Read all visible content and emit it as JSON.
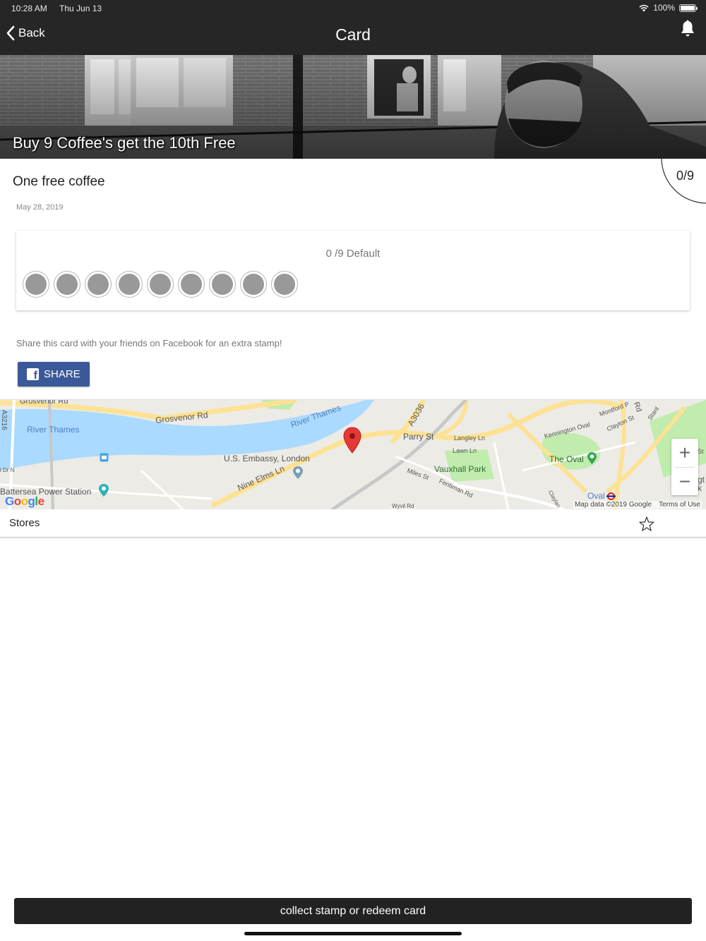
{
  "status_bar": {
    "time": "10:28 AM",
    "date": "Thu Jun 13",
    "battery": "100%"
  },
  "nav": {
    "back_label": "Back",
    "title": "Card",
    "icons": [
      "chevron-left-icon",
      "bell-icon"
    ]
  },
  "hero": {
    "title": "Buy 9 Coffee's get the 10th Free"
  },
  "card": {
    "name": "One free coffee",
    "date": "May 28, 2019",
    "progress": "0/9",
    "progress_fraction": 0
  },
  "stamps": {
    "label": "0 /9 Default",
    "total": 9,
    "collected": 0,
    "empty_color": "#999999"
  },
  "share": {
    "text": "Share this card with your friends on Facebook for an extra stamp!",
    "button_label": "SHARE",
    "button_color": "#3b5998"
  },
  "map": {
    "labels": {
      "grosvenor_rd_top": "Grosvenor Rd",
      "a3216": "A3216",
      "river_thames_left": "River Thames",
      "grosvenor_rd": "Grosvenor Rd",
      "river_thames_right": "River Thames",
      "a3036": "A3036",
      "parry_st": "Parry St",
      "langley_ln": "Langley Ln",
      "lawn_ln": "Lawn Ln",
      "kennington_oval": "Kennington Oval",
      "montford": "Montford P",
      "clayton_st": "Clayton St",
      "rd_vertical": "Rd",
      "us_embassy": "U.S. Embassy, London",
      "vauxhall_park": "Vauxhall Park",
      "the_oval": "The Oval",
      "nine_elms_ln": "Nine Elms Ln",
      "miles_st": "Miles St",
      "fentiman_rd": "Fentiman Rd",
      "battersea": "Battersea Power Station",
      "oval": "Oval",
      "wyvil_rd": "Wyvil Rd",
      "claylands": "Claylan",
      "dr_n": "i Dr N",
      "stanley": "Stanl",
      "right_edge_top": "St",
      "right_edge_mid": "gt",
      "right_edge_low": "k"
    },
    "zoom_in": "+",
    "zoom_out": "−",
    "google": "Google",
    "attribution": "Map data ©2019 Google",
    "terms": "Terms of Use",
    "water_color": "#aadaff",
    "park_color": "#c0ecae",
    "road_color": "#fde293"
  },
  "stores": {
    "label": "Stores"
  },
  "action": {
    "label": "collect stamp or redeem card"
  }
}
